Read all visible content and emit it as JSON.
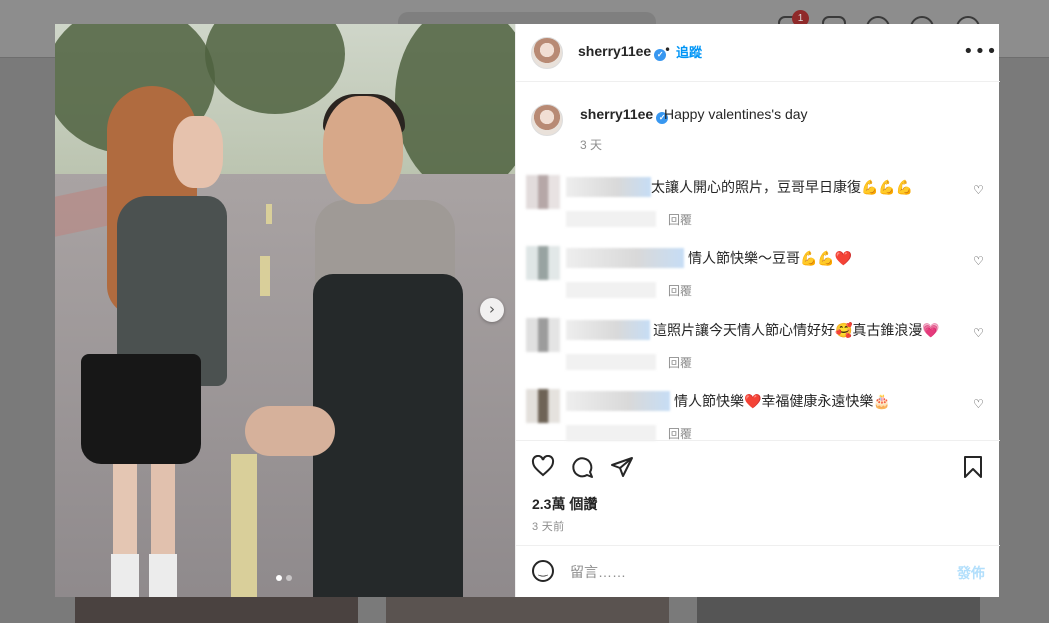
{
  "background": {
    "notification_count": "1"
  },
  "post": {
    "username": "sherry11ee",
    "follow_label": "追蹤",
    "separator": "•",
    "more_label": "•••",
    "caption": "Happy valentines's day",
    "caption_time": "3 天",
    "next_label": "›",
    "comments": [
      {
        "text": "太讓人開心的照片，豆哥早日康復💪💪💪",
        "reply_label": "回覆"
      },
      {
        "text": "情人節快樂～豆哥💪💪❤️",
        "reply_label": "回覆"
      },
      {
        "text": "這照片讓今天情人節心情好好🥰真古錐浪漫💗",
        "reply_label": "回覆"
      },
      {
        "text": "情人節快樂❤️幸福健康永遠快樂🎂",
        "reply_label": "回覆"
      }
    ],
    "likes": "2.3萬 個讚",
    "posted_time": "3 天前",
    "comment_placeholder": "留言……",
    "post_button": "發佈"
  },
  "icons": {
    "like": "heart-icon",
    "comment": "comment-icon",
    "share": "share-icon",
    "save": "bookmark-icon",
    "emoji": "emoji-icon",
    "verified": "verified-badge-icon",
    "next": "chevron-right-icon"
  },
  "colors": {
    "link": "#0095f6",
    "verified": "#3897f0",
    "muted": "#8e8e8e",
    "post_disabled": "#b2dffc"
  }
}
